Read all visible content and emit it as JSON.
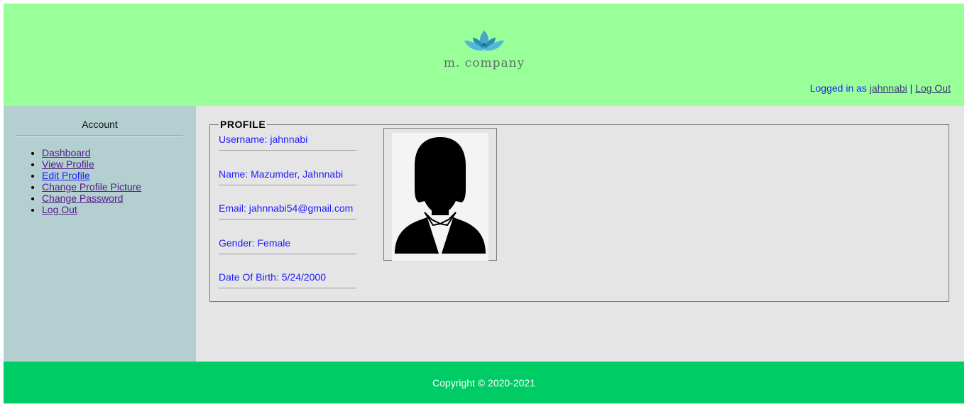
{
  "header": {
    "brand": "m. company",
    "logo_icon": "lotus-icon",
    "logged_in_prefix": "Logged in as",
    "username": "jahnnabi",
    "separator": "|",
    "logout_label": "Log Out",
    "background": "#99ff99"
  },
  "sidebar": {
    "title": "Account",
    "items": [
      {
        "label": "Dashboard"
      },
      {
        "label": "View Profile"
      },
      {
        "label": "Edit Profile"
      },
      {
        "label": "Change Profile Picture"
      },
      {
        "label": "Change Password"
      },
      {
        "label": "Log Out"
      }
    ],
    "background": "#b4cfcf"
  },
  "profile": {
    "legend": "PROFILE",
    "username": "Username: jahnnabi",
    "name": "Name: Mazumder, Jahnnabi",
    "email": "Email: jahnnabi54@gmail.com",
    "gender": "Gender: Female",
    "dob": "Date Of Birth: 5/24/2000",
    "avatar_icon": "person-silhouette-icon"
  },
  "footer": {
    "copyright": "Copyright © 2020-2021",
    "background": "#00cc66"
  }
}
